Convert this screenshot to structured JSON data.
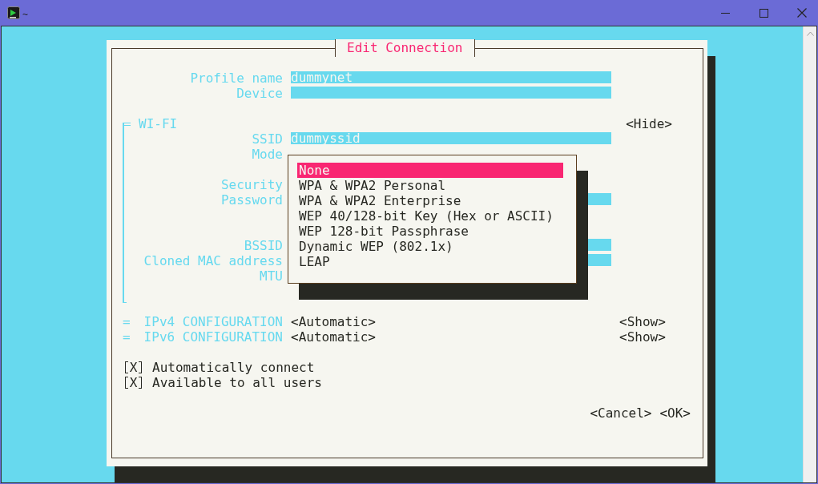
{
  "window": {
    "title": "~"
  },
  "dialog": {
    "title": "Edit Connection",
    "fields": [
      {
        "label": "Profile name",
        "value": "dummynet"
      },
      {
        "label": "Device"
      }
    ],
    "sections": [
      {
        "title": "WI-FI",
        "expanded": true,
        "toggle": "<Hide>",
        "groups": [
          [
            {
              "kind": "field",
              "label": "SSID",
              "value": "dummyssid"
            },
            {
              "kind": "label",
              "label": "Mode"
            }
          ],
          [
            {
              "kind": "label",
              "label": "Security"
            },
            {
              "kind": "field",
              "label": "Password"
            }
          ],
          [
            {
              "kind": "field",
              "label": "BSSID"
            },
            {
              "kind": "field",
              "label": "Cloned MAC address"
            },
            {
              "kind": "label",
              "label": "MTU"
            }
          ]
        ]
      },
      {
        "title": "IPv4 CONFIGURATION",
        "expanded": false,
        "marker": "=",
        "value": "<Automatic>",
        "toggle": "<Show>"
      },
      {
        "title": "IPv6 CONFIGURATION",
        "expanded": false,
        "marker": "=",
        "value": "<Automatic>",
        "toggle": "<Show>"
      }
    ],
    "options": [
      {
        "mark": "X",
        "label": "Automatically connect",
        "checked": true
      },
      {
        "mark": "X",
        "label": "Available to all users",
        "checked": true
      }
    ],
    "buttons": [
      "<Cancel>",
      "<OK>"
    ]
  },
  "popup": {
    "items": [
      {
        "label": "None",
        "selected": true
      },
      {
        "label": "WPA & WPA2 Personal",
        "selected": false
      },
      {
        "label": "WPA & WPA2 Enterprise",
        "selected": false
      },
      {
        "label": "WEP 40/128-bit Key (Hex or ASCII)",
        "selected": false
      },
      {
        "label": "WEP 128-bit Passphrase",
        "selected": false
      },
      {
        "label": "Dynamic WEP (802.1x)",
        "selected": false
      },
      {
        "label": "LEAP",
        "selected": false
      }
    ]
  }
}
